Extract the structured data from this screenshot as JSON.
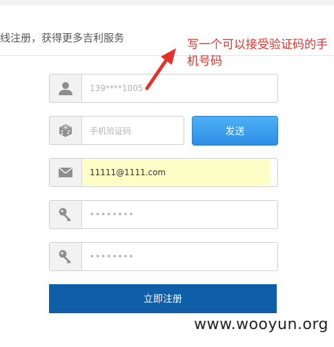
{
  "header": {
    "subtitle": "线注册，获得更多吉利服务"
  },
  "form": {
    "phone_placeholder": "139****1005",
    "code_placeholder": "手机验证码",
    "send_label": "发送",
    "email_value": "11111@1111.com",
    "password_mask": "••••••••",
    "confirm_mask": "••••••••",
    "submit_label": "立即注册"
  },
  "annotation": {
    "text": "写一个可以接受验证码的手机号码"
  },
  "watermark": {
    "text": "www.wooyun.org"
  },
  "colors": {
    "send_button": "#2d8ee6",
    "submit_button": "#0f5ea8",
    "annotation": "#e5302c",
    "email_highlight": "#fdfdc6"
  },
  "icons": [
    "user-icon",
    "dice-icon",
    "envelope-icon",
    "key-icon",
    "key-icon"
  ]
}
